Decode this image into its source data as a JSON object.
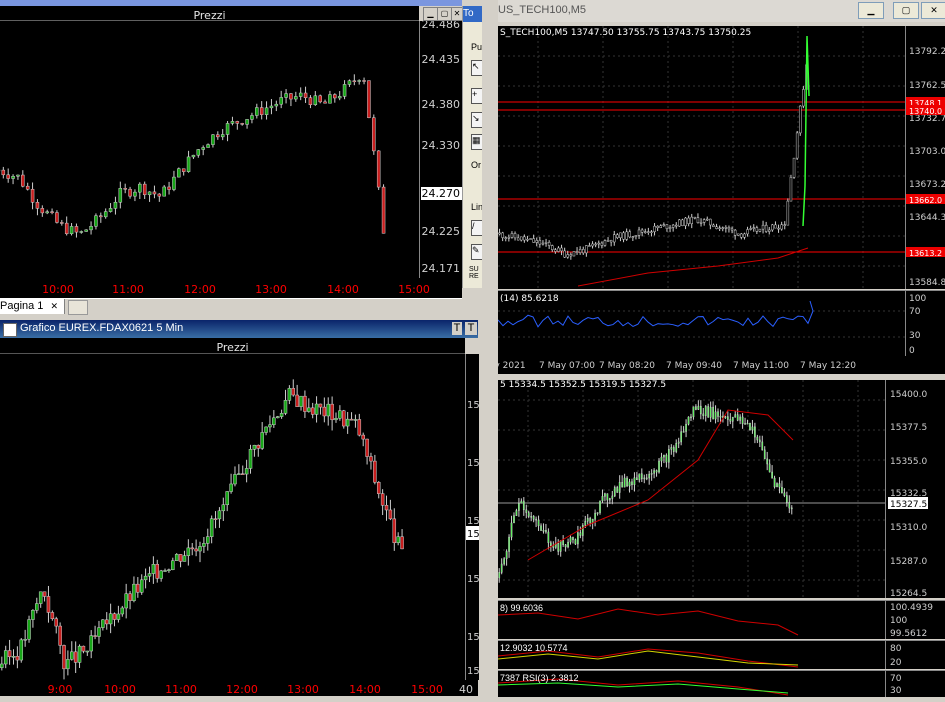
{
  "colors": {
    "bg": "#000000",
    "bull": "#17a617",
    "bear": "#c81e1e",
    "axis_red": "#ff0000",
    "mt4_bull": "#33ff33",
    "ma": "#d00000",
    "indicator_blue": "#2a5fff"
  },
  "win1": {
    "title": "Grafico EUREX.FDAX0621 5 Min",
    "header": "Prezzi",
    "yticks": [
      "24.486",
      "24.435",
      "24.380",
      "24.330",
      "24.270",
      "24.225",
      "24.171"
    ],
    "current_price": "24.270",
    "xticks": [
      "10:00",
      "11:00",
      "12:00",
      "13:00",
      "14:00",
      "15:00"
    ],
    "tab_label": "Pagina 1",
    "tab_close": "✕"
  },
  "win2": {
    "title": "Grafico EUREX.FDAX0621 5 Min",
    "header": "Prezzi",
    "xticks": [
      "9:00",
      "10:00",
      "11:00",
      "12:00",
      "13:00",
      "14:00",
      "15:00"
    ],
    "xtick_last": "40",
    "yticks": [
      "15",
      "15",
      "15",
      "15",
      "15",
      "15",
      "15"
    ],
    "current_price": "15"
  },
  "toolbar_panel": {
    "title": "To",
    "labels": [
      "Pu",
      "Or",
      "Lin",
      "SU RE"
    ]
  },
  "mt4_top": {
    "title": "US_TECH100,M5",
    "ohlc": "S_TECH100,M5  13747.50 13755.75 13743.75 13750.25",
    "yticks": [
      "13792.2",
      "13762.5",
      "13732.7",
      "13703.0",
      "13673.2",
      "13644.3",
      "13584.8"
    ],
    "price_labels": [
      "13748.1",
      "13740.0",
      "13662.0",
      "13613.2"
    ],
    "indicator_label": "(14) 85.6218",
    "indicator_ticks": [
      "100",
      "70",
      "30",
      "0"
    ],
    "xticks": [
      "y 2021",
      "7 May 07:00",
      "7 May 08:20",
      "7 May 09:40",
      "7 May 11:00",
      "7 May 12:20"
    ]
  },
  "mt4_bottom": {
    "ohlc": "5  15334.5 15352.5 15319.5 15327.5",
    "yticks": [
      "15400.0",
      "15377.5",
      "15355.0",
      "15332.5",
      "15310.0",
      "15287.0",
      "15264.5"
    ],
    "current_price": "15327.5",
    "ind1_label": "8) 99.6036",
    "ind1_ticks": [
      "100.4939",
      "100",
      "99.5612"
    ],
    "ind2_label": "12.9032 10.5774",
    "ind2_ticks": [
      "80",
      "20"
    ],
    "ind3_label": "7387  RSI(3) 2.3812",
    "ind3_ticks": [
      "70",
      "30"
    ]
  }
}
